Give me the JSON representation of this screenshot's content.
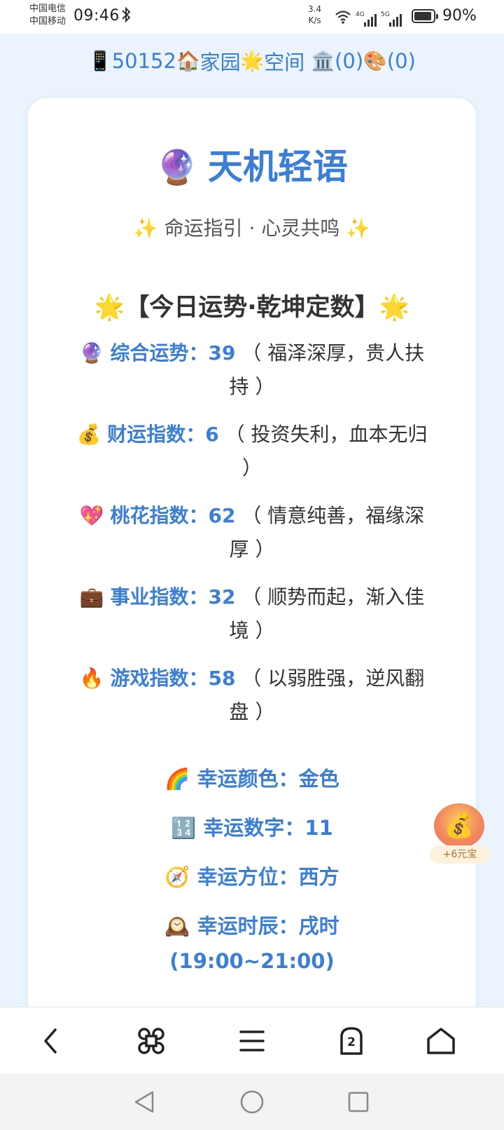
{
  "status_bar": {
    "carrier_1": "中国电信",
    "carrier_2": "中国移动",
    "time": "09:46",
    "net_speed_value": "3.4",
    "net_speed_unit": "K/s",
    "signal_1_label": "4G",
    "signal_2_label": "5G",
    "battery": "90%"
  },
  "top_nav": {
    "phone_icon": "📱",
    "user_id": "50152",
    "home_icon": "🏠",
    "home_label": "家园",
    "star_icon": "🌟",
    "space_label": "空间",
    "bank_icon": "🏛️",
    "bank_count": "(0)",
    "wheel_icon": "🎨",
    "wheel_count": "(0)"
  },
  "card": {
    "title_icon": "🔮",
    "title": "天机轻语",
    "subtitle": "✨ 命运指引 · 心灵共鸣 ✨",
    "section_title": "🌟【今日运势·乾坤定数】🌟",
    "items": [
      {
        "icon": "🔮",
        "label": "综合运势：",
        "value": "39",
        "desc": "（ 福泽深厚，贵人扶持 ）"
      },
      {
        "icon": "💰",
        "label": "财运指数：",
        "value": "6",
        "desc": "（ 投资失利，血本无归 ）"
      },
      {
        "icon": "💖",
        "label": "桃花指数：",
        "value": "62",
        "desc": "（ 情意纯善，福缘深厚 ）"
      },
      {
        "icon": "💼",
        "label": "事业指数：",
        "value": "32",
        "desc": "（ 顺势而起，渐入佳境 ）"
      },
      {
        "icon": "🔥",
        "label": "游戏指数：",
        "value": "58",
        "desc": "（ 以弱胜强，逆风翻盘 ）"
      }
    ],
    "lucky_color": "🌈 幸运颜色：金色",
    "lucky_number": "🔢 幸运数字：11",
    "lucky_direction": "🧭 幸运方位：西方",
    "lucky_time": "🕰️ 幸运时辰：戌时",
    "lucky_time_range": "(19:00~21:00)"
  },
  "reward": {
    "icon": "💰",
    "label": "+6元宝"
  },
  "bottom_bar": {
    "tab_count": "2"
  },
  "colors": {
    "accent": "#3a7fd5",
    "background": "#ebf4fd",
    "card": "#ffffff"
  }
}
